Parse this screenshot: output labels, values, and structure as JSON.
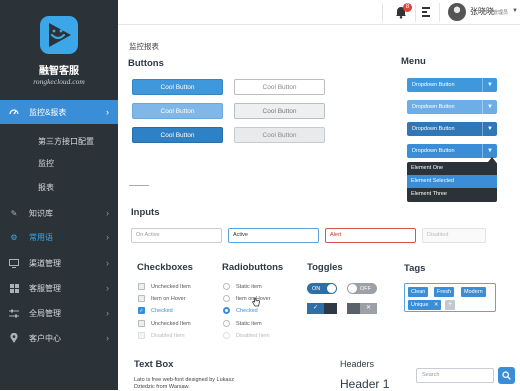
{
  "sidebar": {
    "brand_name": "融智客服",
    "brand_sub": "rongkecloud.com",
    "items": [
      {
        "label": "监控&报表",
        "icon": "dashboard-gauge-icon"
      },
      {
        "label": "知识库",
        "icon": "pencil-icon"
      },
      {
        "label": "常用语",
        "icon": "gear-icon"
      },
      {
        "label": "渠道管理",
        "icon": "monitor-icon"
      },
      {
        "label": "客服管理",
        "icon": "grid-icon"
      },
      {
        "label": "全局管理",
        "icon": "sliders-icon"
      },
      {
        "label": "客户中心",
        "icon": "location-pin-icon"
      }
    ],
    "sub_items": [
      "第三方接口配置",
      "监控",
      "报表"
    ]
  },
  "topbar": {
    "notification_count": "8",
    "user_name": "张晓晓",
    "user_role": "管理员"
  },
  "main": {
    "breadcrumb": "监控报表",
    "buttons_title": "Buttons",
    "buttons": [
      "Cool Button",
      "Cool Button",
      "Cool Button",
      "Cool Button",
      "Cool Button",
      "Cool Button"
    ],
    "menu_title": "Menu",
    "dropdowns": [
      "Dropdown Button",
      "Dropdown Button",
      "Dropdown Button",
      "Dropdown Button"
    ],
    "dropdown_options": [
      "Element One",
      "Element Selected",
      "Element Three"
    ],
    "inputs_title": "Inputs",
    "inputs": {
      "placeholder": "On Active",
      "active": "Active",
      "alert": "Alert",
      "disabled": "Disabled"
    },
    "checkboxes_title": "Checkboxes",
    "checkboxes": [
      "Unchecked Item",
      "Item on Hover",
      "Checked",
      "Unchecked Item",
      "Disabled Item"
    ],
    "radios_title": "Radiobuttons",
    "radios": [
      "Static item",
      "Item on Hover",
      "Checked",
      "Static item",
      "Disabled Item"
    ],
    "toggles_title": "Toggles",
    "toggle_on": "ON",
    "toggle_off": "OFF",
    "tags_title": "Tags",
    "tags": [
      "Clean",
      "Fresh",
      "Modern",
      "Unique"
    ],
    "textbox_title": "Text Box",
    "textbox_line1": "Lato is free web-font designed by Lukasz",
    "textbox_line2": "Dziedzic from Warsaw.",
    "headers_title": "Headers",
    "header1": "Header 1",
    "search_placeholder": "Search"
  },
  "colors": {
    "accent": "#3a8ed8",
    "sidebar": "#2c3338",
    "alert": "#d9534f"
  }
}
